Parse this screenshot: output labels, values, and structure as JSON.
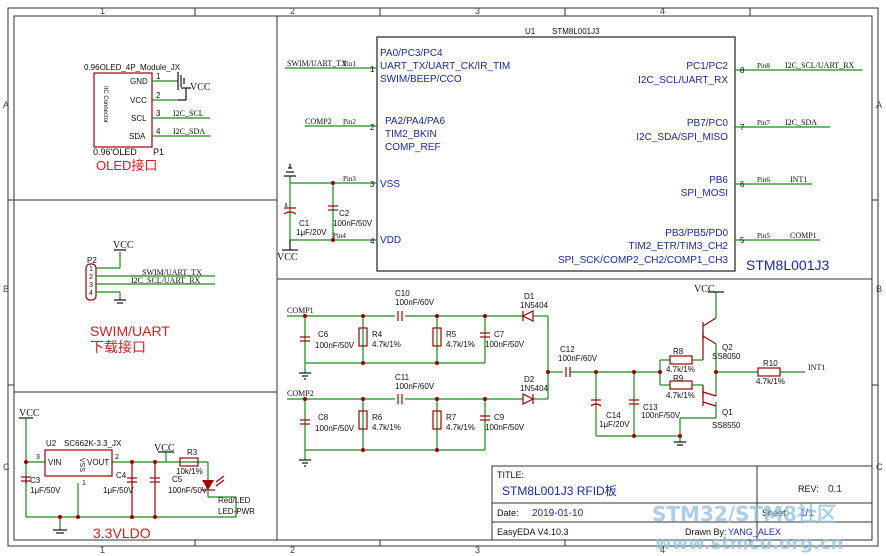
{
  "border": {
    "columns": [
      "1",
      "2",
      "3",
      "4"
    ],
    "rows": [
      "A",
      "B",
      "C"
    ]
  },
  "oled": {
    "module": "0.96OLED_4P_Module_JX",
    "side_label": "IIC Connector",
    "pins": [
      "GND",
      "VCC",
      "SCL",
      "SDA"
    ],
    "pin_numbers": [
      "1",
      "2",
      "3",
      "4"
    ],
    "nets": [
      "VCC",
      "I2C_SCL",
      "I2C_SDA"
    ],
    "value": "0.96'OLED",
    "designator": "P1",
    "section_title": "OLED接口"
  },
  "swim": {
    "designator": "P2",
    "power": "VCC",
    "pin_numbers": [
      "1",
      "2",
      "3",
      "4"
    ],
    "nets": [
      "SWIM/UART_TX",
      "I2C_SCL/UART_RX"
    ],
    "section_title_1": "SWIM/UART",
    "section_title_2": "下载接口"
  },
  "ldo": {
    "power": "VCC",
    "u2": "U2",
    "u2_value": "SC662K-3.3_JX",
    "u2_pins": [
      "VIN",
      "VSS",
      "VOUT"
    ],
    "u2_pin_numbers": [
      "3",
      "1",
      "2"
    ],
    "c3": "C3",
    "c3_value": "1μF/50V",
    "c4": "C4",
    "c4_value": "1μF/50V",
    "c5": "C5",
    "c5_value": "100nF/50V",
    "r3": "R3",
    "r3_value": "10k/1%",
    "led": "Red/LED",
    "led_value": "LED-PWR",
    "power2": "VCC",
    "section_title": "3.3VLDO"
  },
  "mcu": {
    "designator": "U1",
    "value": "STM8L001J3",
    "big_label": "STM8L001J3",
    "left_pins": [
      {
        "num": "1",
        "name_lines": [
          "PA0/PC3/PC4",
          "UART_TX/UART_CK/IR_TIM",
          "SWIM/BEEP/CCO"
        ],
        "pin_label": "Pin1",
        "net": "SWIM/UART_TX"
      },
      {
        "num": "2",
        "name_lines": [
          "PA2/PA4/PA6",
          "TIM2_BKIN",
          "COMP_REF"
        ],
        "pin_label": "Pin2",
        "net": "COMP2"
      },
      {
        "num": "3",
        "name_lines": [
          "VSS"
        ],
        "pin_label": "Pin3",
        "net": ""
      },
      {
        "num": "4",
        "name_lines": [
          "VDD"
        ],
        "pin_label": "Pin4",
        "net": ""
      }
    ],
    "right_pins": [
      {
        "num": "8",
        "name_lines": [
          "PC1/PC2",
          "I2C_SCL/UART_RX"
        ],
        "pin_label": "Pin8",
        "net": "I2C_SCL/UART_RX"
      },
      {
        "num": "7",
        "name_lines": [
          "PB7/PC0",
          "I2C_SDA/SPI_MISO"
        ],
        "pin_label": "Pin7",
        "net": "I2C_SDA"
      },
      {
        "num": "6",
        "name_lines": [
          "PB6",
          "SPI_MOSI"
        ],
        "pin_label": "Pin6",
        "net": "INT1"
      },
      {
        "num": "5",
        "name_lines": [
          "PB3/PB5/PD0",
          "TIM2_ETR/TIM3_CH2",
          "SPI_SCK/COMP2_CH2/COMP1_CH3"
        ],
        "pin_label": "Pin5",
        "net": "COMP1"
      }
    ],
    "c1": "C1",
    "c1_value": "1μF/20V",
    "c2": "C2",
    "c2_value": "100nF/50V",
    "vcc": "VCC"
  },
  "rfid": {
    "comp1": "COMP1",
    "comp2": "COMP2",
    "c6": "C6",
    "c6_value": "100nF/50V",
    "r4": "R4",
    "r4_value": "4.7k/1%",
    "c10": "C10",
    "c10_value": "100nF/60V",
    "r5": "R5",
    "r5_value": "4.7k/1%",
    "c7": "C7",
    "c7_value": "100nF/50V",
    "d1": "D1",
    "d1_value": "1N5404",
    "c8": "C8",
    "c8_value": "100nF/50V",
    "r6": "R6",
    "r6_value": "4.7k/1%",
    "c11": "C11",
    "c11_value": "100nF/60V",
    "r7": "R7",
    "r7_value": "4.7k/1%",
    "c9": "C9",
    "c9_value": "100nF/50V",
    "d2": "D2",
    "d2_value": "1N5404",
    "c12": "C12",
    "c12_value": "100nF/60V",
    "c14": "C14",
    "c14_value": "1μF/20V",
    "c13": "C13",
    "c13_value": "100nF/50V",
    "r8": "R8",
    "r8_value": "4.7k/1%",
    "r9": "R9",
    "r9_value": "4.7k/1%",
    "q2": "Q2",
    "q2_value": "SS8050",
    "q1": "Q1",
    "q1_value": "SS8550",
    "r10": "R10",
    "r10_value": "4.7k/1%",
    "int1": "INT1",
    "vcc": "VCC"
  },
  "titleblock": {
    "title_label": "TITLE:",
    "title": "STM8L001J3 RFID板",
    "rev_label": "REV:",
    "rev": "0.1",
    "date_label": "Date:",
    "date": "2019-01-10",
    "sheet_label": "Sheet:",
    "sheet": "1/1",
    "tool": "EasyEDA V4.10.3",
    "drawn_label": "Drawn By:",
    "drawn_by": "YANG_ALEX"
  },
  "watermark": {
    "line1": "STM32/STM8社区",
    "line2": "www.stmcu.org.cn"
  },
  "colors": {
    "wire": "#1a8a1a",
    "component": "#a00000",
    "label_blue": "#1a2aa0",
    "section_red": "#cc2222"
  }
}
